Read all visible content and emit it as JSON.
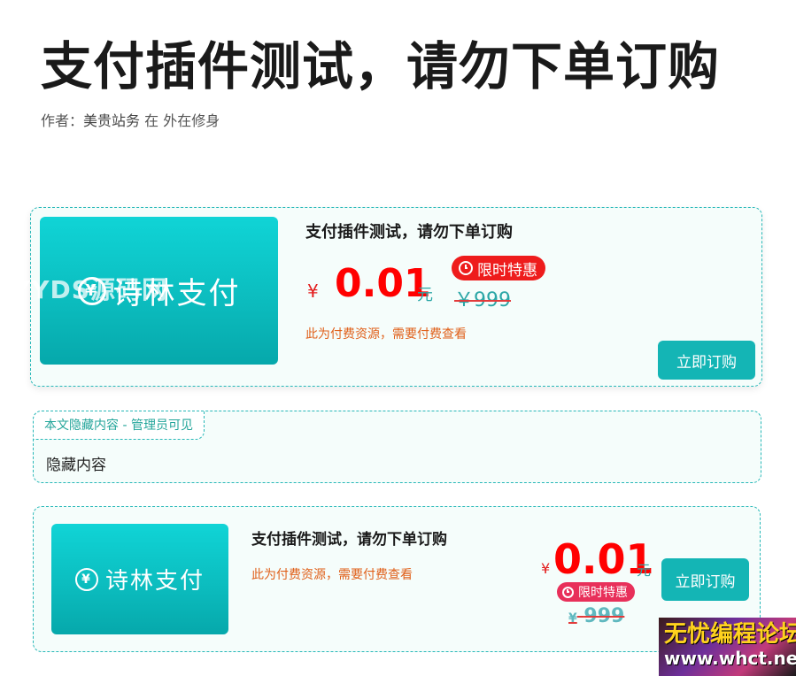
{
  "article": {
    "title": "支付插件测试，请勿下单订购",
    "meta_prefix": "作者：",
    "author": "美贵站务",
    "meta_suffix": "在 外在修身"
  },
  "card1": {
    "thumb_brand": "诗林支付",
    "watermark": "YYDS源码网",
    "title": "支付插件测试，请勿下单订购",
    "currency": "¥",
    "price": "0.01",
    "unit": "元",
    "badge": "限时特惠",
    "original_price": "￥999",
    "note": "此为付费资源，需要付费查看",
    "button": "立即订购"
  },
  "hidden": {
    "tab": "本文隐藏内容 - 管理员可见",
    "content": "隐藏内容"
  },
  "card2": {
    "thumb_brand": "诗林支付",
    "title": "支付插件测试，请勿下单订购",
    "note": "此为付费资源，需要付费查看",
    "currency": "¥",
    "price": "0.01",
    "unit": "元",
    "badge": "限时特惠",
    "original_currency": "¥",
    "original_price": "999",
    "button": "立即订购"
  },
  "logo": {
    "line1": "无忧编程论坛",
    "line2": "www.whct.net"
  },
  "colors": {
    "accent": "#14b5b5",
    "price_red": "#ff0000",
    "note_orange": "#e0601a",
    "badge_red": "#ee1c1c"
  }
}
